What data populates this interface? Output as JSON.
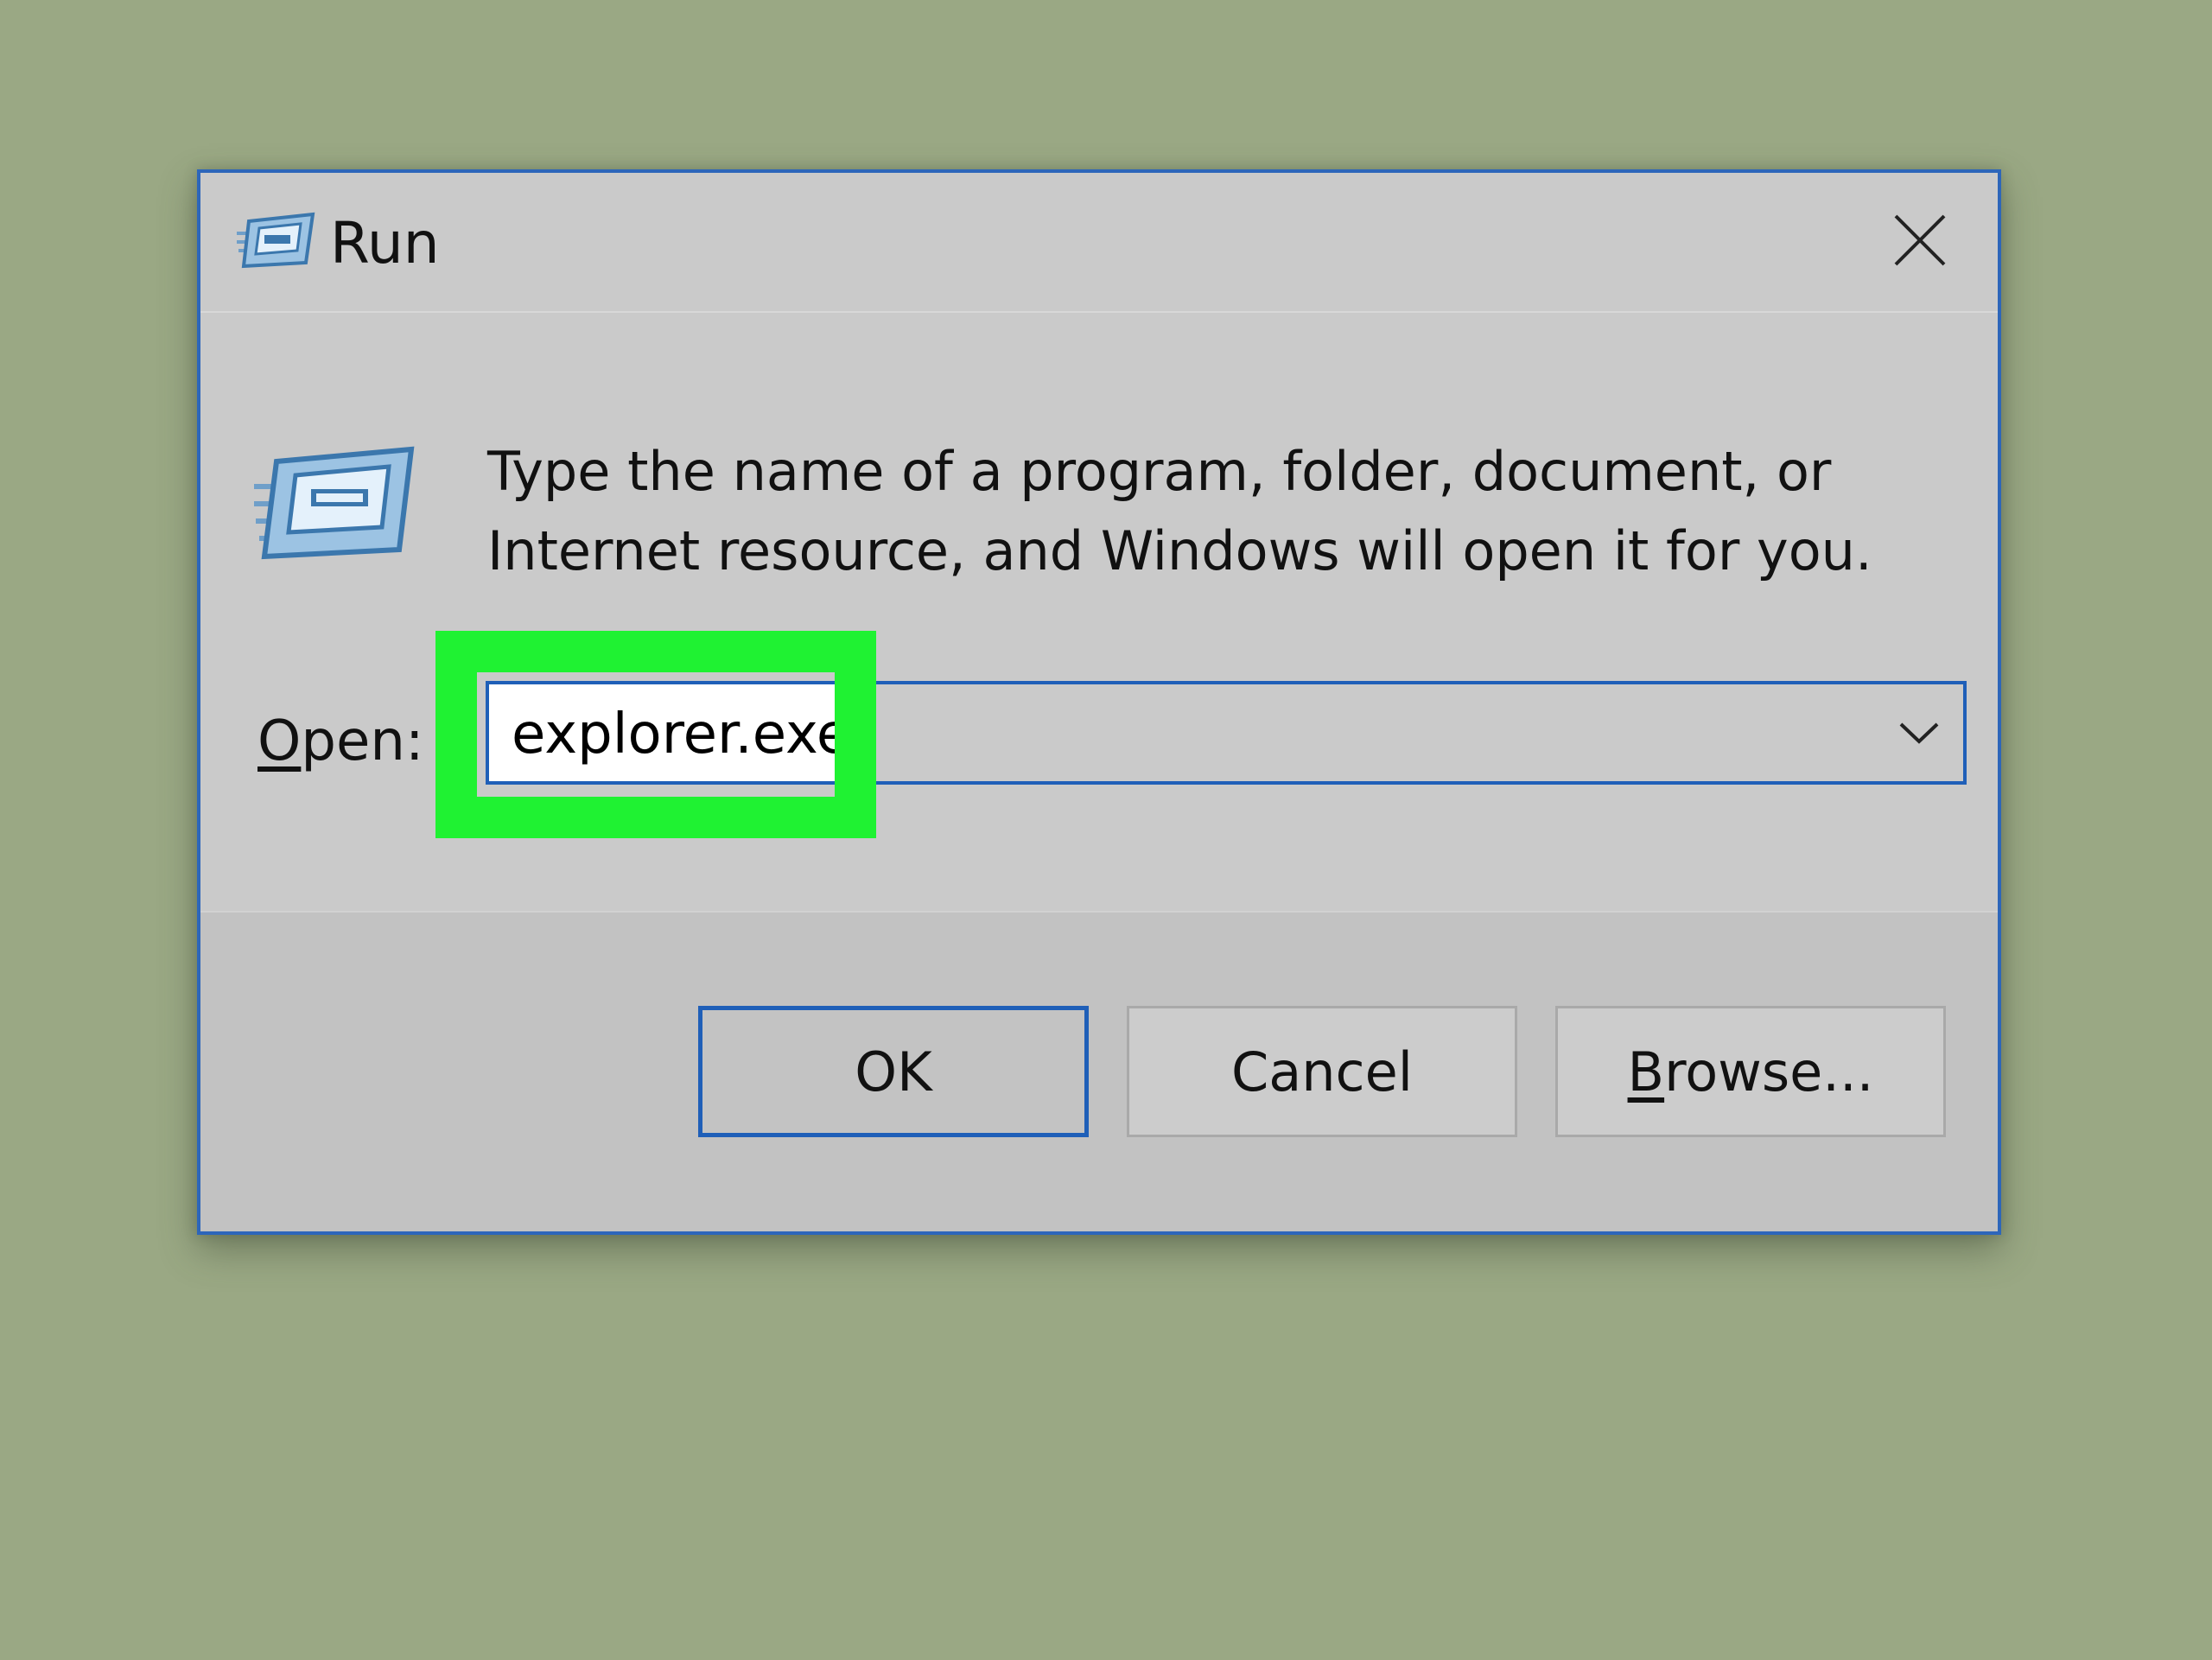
{
  "window": {
    "title": "Run",
    "close_icon": "close-icon",
    "title_icon": "run-icon"
  },
  "content": {
    "icon": "run-icon",
    "description_line1": "Type the name of a program, folder, document, or",
    "description_line2": "Internet resource, and Windows will open it for you."
  },
  "open_field": {
    "label_mnemonic": "O",
    "label_rest": "pen:",
    "value": "explorer.exe",
    "dropdown_icon": "chevron-down-icon"
  },
  "buttons": {
    "ok": "OK",
    "cancel": "Cancel",
    "browse_mnemonic": "B",
    "browse_rest": "rowse..."
  },
  "colors": {
    "background": "#9aa884",
    "dialog": "#cacaca",
    "accent_border": "#1f5fb8",
    "highlight": "#1ff232"
  }
}
